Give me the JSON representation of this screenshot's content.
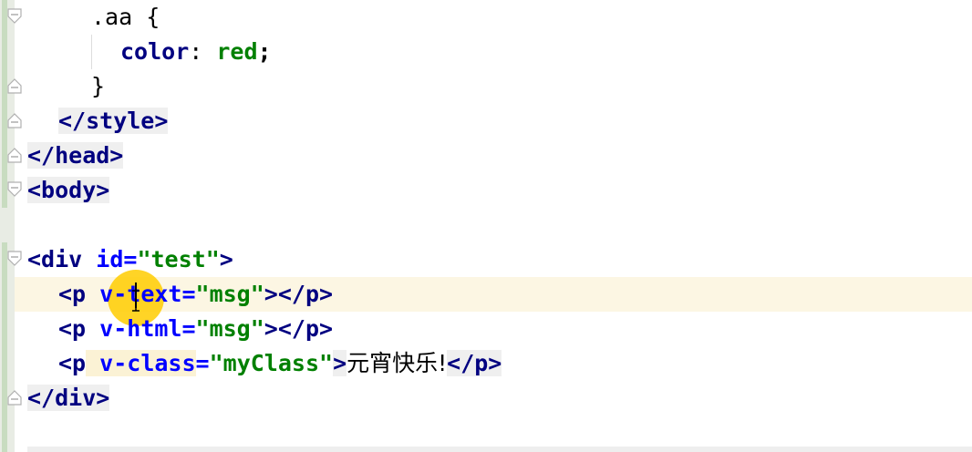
{
  "lines": {
    "l1": {
      "selector": ".aa",
      "brace": " {"
    },
    "l2": {
      "prop": "color",
      "colon": ": ",
      "value": "red",
      "semi": ";"
    },
    "l3": {
      "brace": "}"
    },
    "l4": {
      "tag": "</style>"
    },
    "l5": {
      "tag": "</head>"
    },
    "l6": {
      "tag": "<body>"
    },
    "l8": {
      "open": "<div",
      "attr": " id=",
      "val": "\"test\"",
      "close": ">"
    },
    "l9": {
      "open": "<p",
      "attr_a": " v-",
      "attr_b": "text=",
      "val": "\"msg\"",
      "close": "></p>"
    },
    "l10": {
      "open": "<p",
      "attr": " v-html=",
      "val": "\"msg\"",
      "close": "></p>"
    },
    "l11": {
      "open": "<p",
      "attr_hl": " v-class",
      "attr_rest": "=",
      "val": "\"myClass\"",
      "close": ">",
      "text": "元宵快乐!",
      "end": "</p>"
    },
    "l12": {
      "tag": "</div>"
    }
  },
  "colors": {
    "tag": "#000080",
    "attribute": "#0000ff",
    "string": "#008000",
    "current_line": "#fcf6e3",
    "cursor_highlight": "#ffcc00"
  },
  "icons": [
    "fold-icon",
    "text-cursor-icon"
  ]
}
